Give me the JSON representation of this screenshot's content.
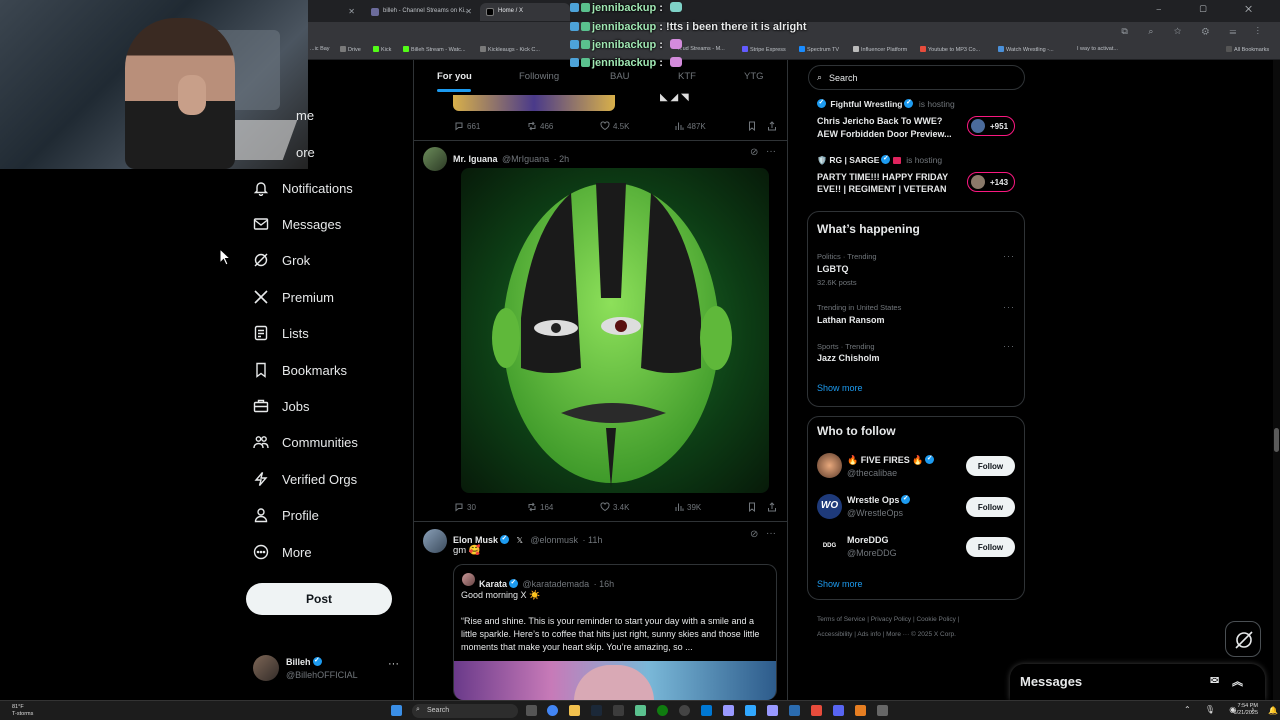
{
  "browser": {
    "tabs": [
      {
        "label": "billeh - Channel Streams on Ki..."
      },
      {
        "label": "Home / X"
      }
    ],
    "bookmarks": [
      "...ic Bay",
      "Drive",
      "Kick",
      "Billeh Stream - Watc...",
      "Kickleaugs - Kick C...",
      "...ud Streams - M...",
      "Stripe Express",
      "Spectrum TV",
      "Influencer Platform",
      "Youtube to MP3 Co...",
      "Watch Wrestling -...",
      "I way to activat...",
      "All Bookmarks"
    ]
  },
  "chat": [
    {
      "user": "jennibackup",
      "msg": ""
    },
    {
      "user": "jennibackup",
      "msg": "!tts i been there it is alright"
    },
    {
      "user": "jennibackup",
      "msg": ""
    },
    {
      "user": "jennibackup",
      "msg": ""
    }
  ],
  "nav": {
    "partial": [
      "me",
      "ore"
    ],
    "items": [
      {
        "label": "Notifications",
        "icon": "bell-icon"
      },
      {
        "label": "Messages",
        "icon": "mail-icon"
      },
      {
        "label": "Grok",
        "icon": "grok-icon"
      },
      {
        "label": "Premium",
        "icon": "x-logo-icon"
      },
      {
        "label": "Lists",
        "icon": "list-icon"
      },
      {
        "label": "Bookmarks",
        "icon": "bookmark-icon"
      },
      {
        "label": "Jobs",
        "icon": "briefcase-icon"
      },
      {
        "label": "Communities",
        "icon": "people-icon"
      },
      {
        "label": "Verified Orgs",
        "icon": "lightning-icon"
      },
      {
        "label": "Profile",
        "icon": "person-icon"
      },
      {
        "label": "More",
        "icon": "more-circle-icon"
      }
    ],
    "post_label": "Post",
    "account": {
      "name": "Billeh",
      "handle": "@BillehOFFICIAL"
    }
  },
  "feed": {
    "tabs": [
      "For you",
      "Following",
      "BAU",
      "KTF",
      "YTG"
    ],
    "top_post_stats": {
      "replies": "661",
      "reposts": "466",
      "likes": "4.5K",
      "views": "487K"
    },
    "post1": {
      "name": "Mr. Iguana",
      "handle": "@MrIguana",
      "time": "· 2h",
      "stats": {
        "replies": "30",
        "reposts": "164",
        "likes": "3.4K",
        "views": "39K"
      }
    },
    "post2": {
      "name": "Elon Musk",
      "handle": "@elonmusk",
      "time": "· 11h",
      "text": "gm 🥰",
      "quote": {
        "name": "Karata",
        "handle": "@karatademada",
        "time": "· 16h",
        "line1": "Good morning X ☀️",
        "body": "“Rise and shine. This is your reminder to start your day with a smile and a little sparkle. Here’s to coffee that hits just right, sunny skies and those little moments that make your heart skip. You’re amazing, so ..."
      }
    }
  },
  "right": {
    "search_placeholder": "Search",
    "live": [
      {
        "name": "Fightful Wrestling",
        "status": "is hosting",
        "title1": "Chris Jericho Back To WWE?",
        "title2": "AEW Forbidden Door Preview...",
        "count": "+951"
      },
      {
        "name": "RG | SARGE",
        "status": "is hosting",
        "title1": "PARTY TIME!!! HAPPY FRIDAY",
        "title2": "EVE!! | REGIMENT | VETERAN",
        "count": "+143"
      }
    ],
    "happening_title": "What’s happening",
    "trends": [
      {
        "context": "Politics · Trending",
        "name": "LGBTQ",
        "posts": "32.6K posts"
      },
      {
        "context": "Trending in United States",
        "name": "Lathan Ransom",
        "posts": ""
      },
      {
        "context": "Sports · Trending",
        "name": "Jazz Chisholm",
        "posts": ""
      }
    ],
    "show_more": "Show more",
    "who_title": "Who to follow",
    "follow": [
      {
        "name": "🔥 FIVE FIRES 🔥",
        "handle": "@thecalibae",
        "btn": "Follow"
      },
      {
        "name": "Wrestle Ops",
        "handle": "@WrestleOps",
        "btn": "Follow"
      },
      {
        "name": "MoreDDG",
        "handle": "@MoreDDG",
        "btn": "Follow"
      }
    ],
    "footer1": "Terms of Service  |  Privacy Policy  |  Cookie Policy  |",
    "footer2": "Accessibility  |  Ads info  |  More ···  © 2025 X Corp.",
    "messages_title": "Messages"
  },
  "taskbar": {
    "weather_temp": "81°F",
    "weather_desc": "T-storms",
    "search_label": "Search",
    "time": "7:54 PM",
    "date": "6/21/2025"
  }
}
